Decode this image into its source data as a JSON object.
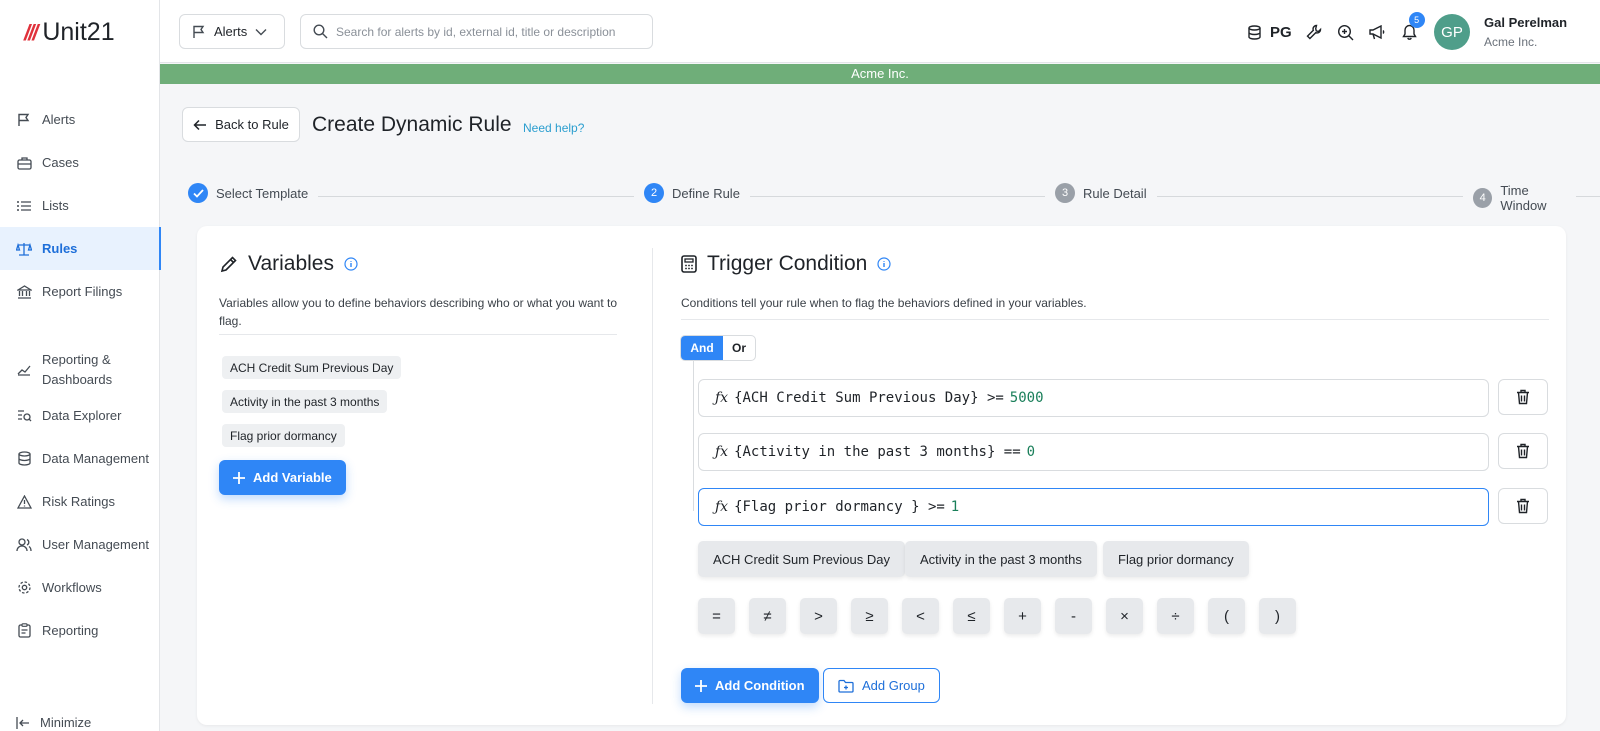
{
  "brand": {
    "mark": "///",
    "name": "Unit21"
  },
  "sidebar": {
    "items": [
      {
        "label": "Alerts"
      },
      {
        "label": "Cases"
      },
      {
        "label": "Lists"
      },
      {
        "label": "Rules"
      },
      {
        "label": "Report Filings"
      },
      {
        "label": "Reporting & Dashboards"
      },
      {
        "label": "Data Explorer"
      },
      {
        "label": "Data Management"
      },
      {
        "label": "Risk Ratings"
      },
      {
        "label": "User Management"
      },
      {
        "label": "Workflows"
      },
      {
        "label": "Reporting"
      }
    ],
    "active": "Rules",
    "minimize_label": "Minimize"
  },
  "topbar": {
    "dropdown_label": "Alerts",
    "search_placeholder": "Search for alerts by id, external id, title or description",
    "pg_label": "PG",
    "notification_count": "5",
    "avatar_initials": "GP",
    "user_name": "Gal Perelman",
    "user_org": "Acme Inc."
  },
  "org_banner": "Acme Inc.",
  "header": {
    "back_label": "Back to Rule",
    "title": "Create Dynamic Rule",
    "help_label": "Need help?"
  },
  "stepper": {
    "steps": [
      {
        "num": "",
        "label": "Select Template",
        "state": "done"
      },
      {
        "num": "2",
        "label": "Define Rule",
        "state": "active"
      },
      {
        "num": "3",
        "label": "Rule Detail",
        "state": "pending"
      },
      {
        "num": "4",
        "label": "Time Window",
        "state": "pending"
      }
    ]
  },
  "variables": {
    "title": "Variables",
    "description": "Variables allow you to define behaviors describing who or what you want to flag.",
    "items": [
      "ACH Credit Sum Previous Day",
      "Activity in the past 3 months",
      "Flag prior dormancy"
    ],
    "add_label": "Add Variable"
  },
  "trigger": {
    "title": "Trigger Condition",
    "description": "Conditions tell your rule when to flag the behaviors defined in your variables.",
    "logic": {
      "and_label": "And",
      "or_label": "Or",
      "selected": "And"
    },
    "conditions": [
      {
        "expr": "{ACH Credit Sum Previous Day} >=",
        "value": "5000"
      },
      {
        "expr": "{Activity in the past 3 months} ==",
        "value": "0"
      },
      {
        "expr": "{Flag prior dormancy } >=",
        "value": "1"
      }
    ],
    "variable_chips": [
      "ACH Credit Sum Previous Day",
      "Activity in the past 3 months",
      "Flag prior dormancy"
    ],
    "operators": [
      "=",
      "≠",
      ">",
      "≥",
      "<",
      "≤",
      "+",
      "-",
      "×",
      "÷",
      "(",
      ")"
    ],
    "add_condition_label": "Add Condition",
    "add_group_label": "Add Group"
  },
  "colors": {
    "accent": "#2f86f6",
    "banner": "#6fae79",
    "brand_red": "#e0313b"
  }
}
